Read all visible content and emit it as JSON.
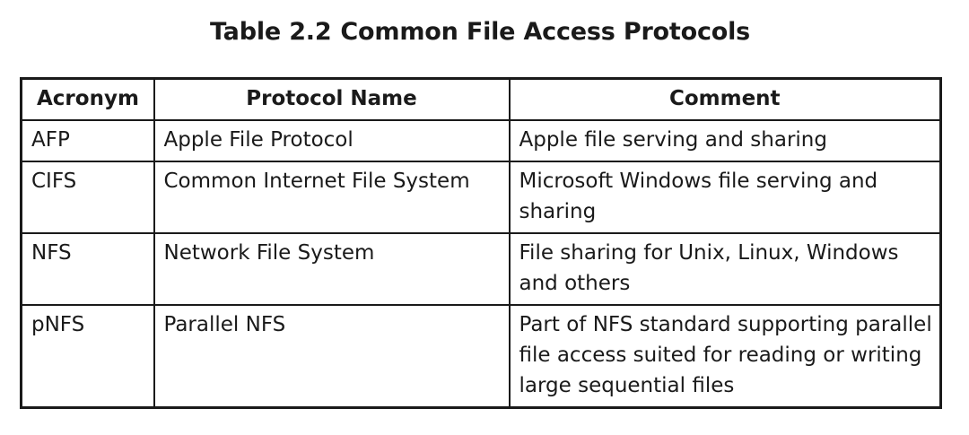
{
  "table": {
    "number": "Table 2.2",
    "title": "Common File Access Protocols",
    "headers": [
      "Acronym",
      "Protocol Name",
      "Comment"
    ],
    "rows": [
      [
        "AFP",
        "Apple File Protocol",
        "Apple file serving and sharing"
      ],
      [
        "CIFS",
        "Common Internet File System",
        "Microsoft Windows file serving and sharing"
      ],
      [
        "NFS",
        "Network File System",
        "File sharing for Unix, Linux, Windows and others"
      ],
      [
        "pNFS",
        "Parallel NFS",
        "Part of NFS standard supporting parallel file access suited for reading or writing large sequential files"
      ]
    ]
  }
}
